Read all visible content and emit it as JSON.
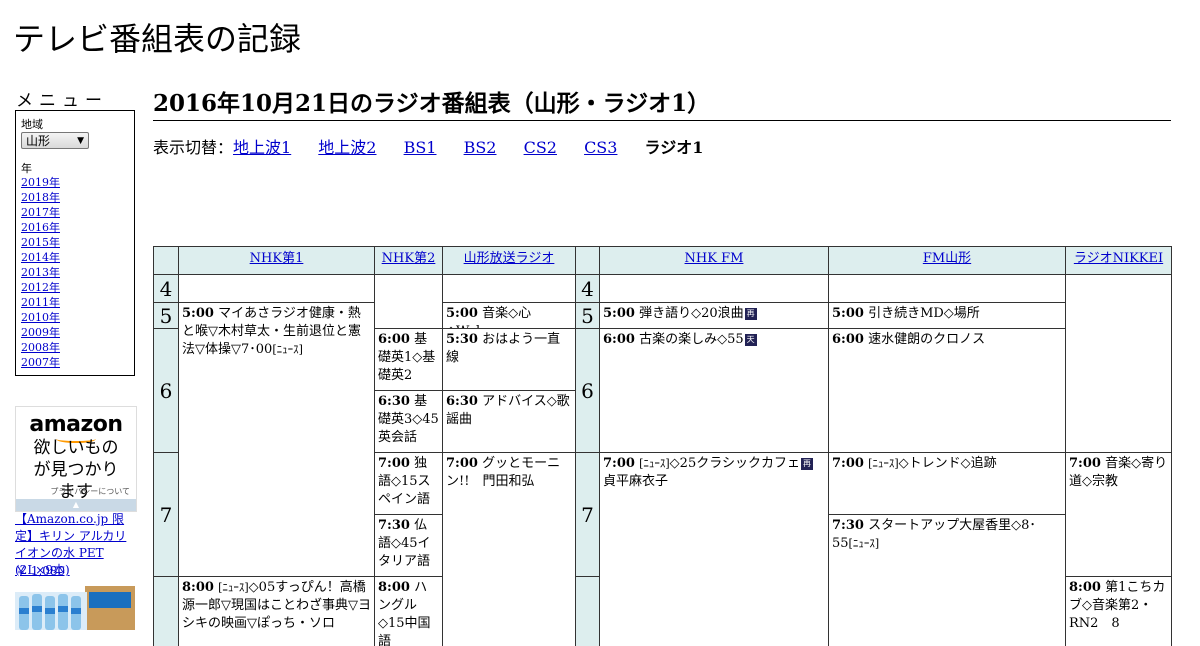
{
  "site_title": "テレビ番組表の記録",
  "menu": {
    "title": "メニュー",
    "region_label": "地域",
    "region_value": "山形",
    "year_label": "年",
    "years": [
      "2019年",
      "2018年",
      "2017年",
      "2016年",
      "2015年",
      "2014年",
      "2013年",
      "2012年",
      "2011年",
      "2010年",
      "2009年",
      "2008年",
      "2007年"
    ]
  },
  "ad": {
    "brand": "amazon",
    "tagline": "欲しいものが見つかります",
    "privacy": "プライバシーについて",
    "product_title": "【Amazon.co.jp 限定】キリン アルカリイオンの水 PET (2L×9本)",
    "product_price": "￥ 1,080"
  },
  "page_heading": "2016年10月21日のラジオ番組表（山形・ラジオ1）",
  "switcher": {
    "label": "表示切替：",
    "links": [
      "地上波1",
      "地上波2",
      "BS1",
      "BS2",
      "CS2",
      "CS3"
    ],
    "current": "ラジオ1"
  },
  "channels": [
    "NHK第1",
    "NHK第2",
    "山形放送ラジオ",
    "NHK FM",
    "FM山形",
    "ラジオNIKKEI"
  ],
  "hours": [
    "4",
    "5",
    "6",
    "7"
  ],
  "programs": {
    "nhk1_a": {
      "time": "5:00",
      "title": "マイあさラジオ健康・熱と喉▽木村草太・生前退位と憲法▽体操▽7･00",
      "tag": "[ﾆｭｰｽ]"
    },
    "nhk1_b": {
      "time": "8:00",
      "tag": "[ﾆｭｰｽ]",
      "title": "◇05すっぴん！高橋源一郎▽現国はことわざ事典▽ヨシキの映画▽ぽっち・ソロ"
    },
    "nhk2_a": {
      "time": "6:00",
      "title": "基礎英1◇基礎英2"
    },
    "nhk2_b": {
      "time": "6:30",
      "title": "基礎英3◇45英会話"
    },
    "nhk2_c": {
      "time": "7:00",
      "title": "独語◇15スペイン語"
    },
    "nhk2_d": {
      "time": "7:30",
      "title": "仏語◇45イタリア語"
    },
    "nhk2_e": {
      "time": "8:00",
      "title": "ハングル◇15中国語"
    },
    "ybc_a": {
      "time": "5:00",
      "title": "音楽◇心◇Wake"
    },
    "ybc_b": {
      "time": "5:30",
      "title": "おはよう一直線"
    },
    "ybc_c": {
      "time": "6:30",
      "title": "アドバイス◇歌謡曲"
    },
    "ybc_d": {
      "time": "7:00",
      "title": "グッとモーニン!!　門田和弘"
    },
    "fm_a": {
      "time": "5:00",
      "title": "弾き語り◇20浪曲",
      "icon": "再"
    },
    "fm_b": {
      "time": "6:00",
      "title": "古楽の楽しみ◇55",
      "icon": "天"
    },
    "fm_c": {
      "time": "7:00",
      "tag": "[ﾆｭｰｽ]",
      "title": "◇25クラシックカフェ",
      "icon": "再",
      "title2": "貞平麻衣子"
    },
    "fmy_a": {
      "time": "5:00",
      "title": "引き続きMD◇場所"
    },
    "fmy_b": {
      "time": "6:00",
      "title": "速水健朗のクロノス"
    },
    "fmy_c": {
      "time": "7:00",
      "tag": "[ﾆｭｰｽ]",
      "title": "◇トレンド◇追跡"
    },
    "fmy_d": {
      "time": "7:30",
      "title": "スタートアップ大屋香里◇8･55",
      "tag": "[ﾆｭｰｽ]"
    },
    "nikkei_a": {
      "time": "7:00",
      "title": "音楽◇寄り道◇宗教"
    },
    "nikkei_b": {
      "time": "8:00",
      "title": "第1こちカブ◇音楽第2・RN2　8"
    }
  }
}
